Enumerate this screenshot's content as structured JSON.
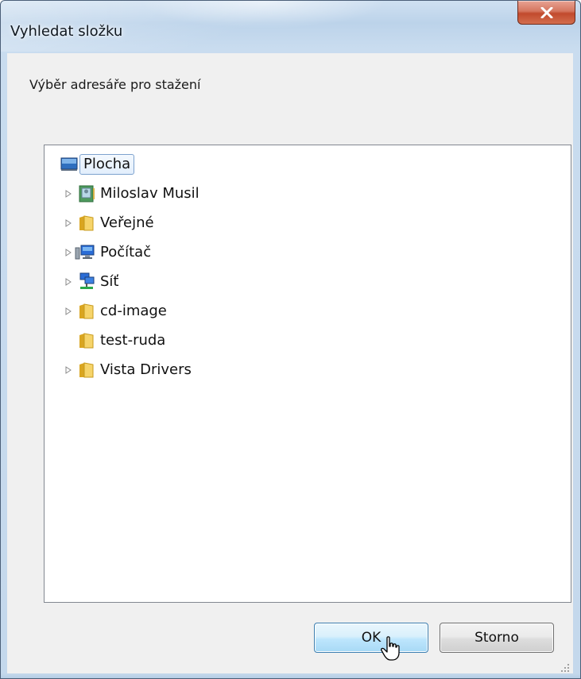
{
  "window": {
    "title": "Vyhledat složku"
  },
  "dialog": {
    "instruction": "Výběr adresáře pro stažení"
  },
  "tree": {
    "items": [
      {
        "label": "Plocha",
        "icon": "desktop-icon",
        "expandable": false,
        "selected": true
      },
      {
        "label": "Miloslav Musil",
        "icon": "user-folder-icon",
        "expandable": true
      },
      {
        "label": "Veřejné",
        "icon": "folder-icon",
        "expandable": true
      },
      {
        "label": "Počítač",
        "icon": "computer-icon",
        "expandable": true
      },
      {
        "label": "Síť",
        "icon": "network-icon",
        "expandable": true
      },
      {
        "label": "cd-image",
        "icon": "folder-icon",
        "expandable": true
      },
      {
        "label": "test-ruda",
        "icon": "folder-icon",
        "expandable": false
      },
      {
        "label": "Vista Drivers",
        "icon": "folder-icon",
        "expandable": true
      }
    ]
  },
  "buttons": {
    "ok": "OK",
    "cancel": "Storno"
  },
  "colors": {
    "selection_border": "#7da2ce",
    "ok_border": "#3c7fb1",
    "close_red": "#c14a2d"
  }
}
